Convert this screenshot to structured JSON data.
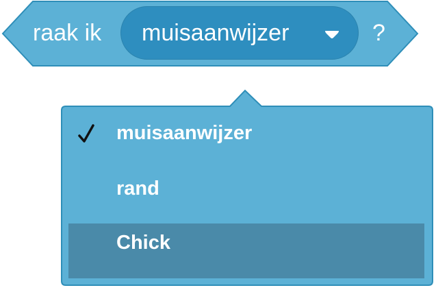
{
  "block": {
    "prefix_label": "raak ik",
    "selected_value": "muisaanwijzer",
    "suffix_label": "?",
    "dropdown_icon": "caret-down-icon"
  },
  "menu": {
    "items": [
      {
        "label": "muisaanwijzer",
        "checked": true,
        "highlighted": false
      },
      {
        "label": "rand",
        "checked": false,
        "highlighted": false
      },
      {
        "label": "Chick",
        "checked": false,
        "highlighted": true
      }
    ],
    "check_icon": "checkmark-icon"
  },
  "colors": {
    "block_fill": "#5cb1d6",
    "block_border": "#2e8eb8",
    "field_fill": "#2e8ebf",
    "menu_fill": "#5cb1d6",
    "menu_border": "#2e8eb8",
    "highlight": "#4a8aa9",
    "text": "#ffffff"
  }
}
